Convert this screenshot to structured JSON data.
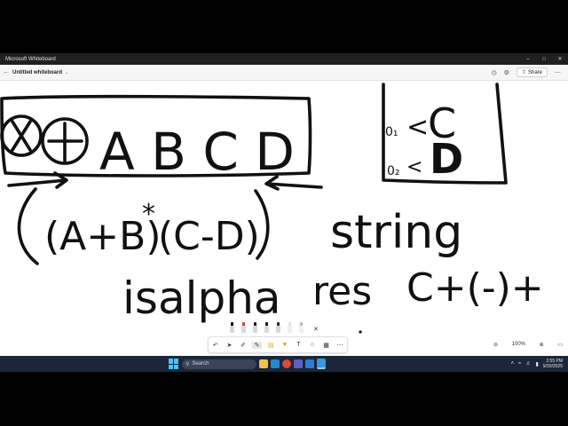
{
  "window": {
    "title": "Microsoft Whiteboard",
    "controls": [
      "minimize-icon",
      "maximize-icon",
      "close-icon"
    ]
  },
  "appbar": {
    "back_icon": "back-arrow-icon",
    "whiteboard_name": "Untitled whiteboard",
    "share_label": "Share",
    "icons": [
      "timer-icon",
      "settings-icon",
      "share-icon"
    ]
  },
  "canvas": {
    "ink_texts": {
      "ops": "&&",
      "letters": "A B C D",
      "expr_a": "(A+B)",
      "star": "*",
      "expr_b": "(C-D)",
      "word_string": "string",
      "word_isalpha": "isalpha",
      "word_res": "res",
      "expr_c": "C+(-)+",
      "box_c": "C",
      "box_d": "D",
      "box_sub1": "0₁",
      "box_sub2": "0₂",
      "arrow": "<"
    }
  },
  "pen_tray": {
    "pens": [
      {
        "name": "black-pen-icon",
        "tip": "#111111"
      },
      {
        "name": "red-pen-icon",
        "tip": "#d23a3a"
      },
      {
        "name": "blue-pen-icon",
        "tip": "#1a1a1a"
      },
      {
        "name": "black-pen-2-icon",
        "tip": "#1a1a1a"
      },
      {
        "name": "yellow-highlighter-icon",
        "tip": "#2a2a2a"
      },
      {
        "name": "eraser-icon",
        "tip": "#e0e0e0"
      },
      {
        "name": "lasso-icon",
        "tip": "#bbbbbb"
      }
    ],
    "close_icon": "✕"
  },
  "toolbar": {
    "items": [
      {
        "name": "undo-icon",
        "glyph": "↶"
      },
      {
        "name": "select-icon",
        "glyph": "➤"
      },
      {
        "name": "ink-tools-icon",
        "glyph": "✐"
      },
      {
        "name": "pen-icon",
        "glyph": "✎"
      },
      {
        "name": "sticky-note-icon",
        "glyph": "▤"
      },
      {
        "name": "reactions-icon",
        "glyph": "♥"
      },
      {
        "name": "text-icon",
        "glyph": "T"
      },
      {
        "name": "shapes-icon",
        "glyph": "○"
      },
      {
        "name": "templates-icon",
        "glyph": "▦"
      },
      {
        "name": "more-icon",
        "glyph": "⋯"
      }
    ]
  },
  "zoom": {
    "level": "100%",
    "zoom_out": "⊖",
    "zoom_in": "⊕",
    "fit_icon": "▭"
  },
  "taskbar": {
    "search_placeholder": "Search",
    "time": "3:55 PM",
    "date": "9/30/2025",
    "apps": [
      {
        "name": "file-explorer-icon",
        "color": "#f2c14e"
      },
      {
        "name": "edge-icon",
        "color": "#1f8ad2"
      },
      {
        "name": "chrome-icon",
        "color": "#d84a3a"
      },
      {
        "name": "teams-icon",
        "color": "#5b5fc7"
      },
      {
        "name": "store-icon",
        "color": "#2d7dd2"
      },
      {
        "name": "whiteboard-app-icon",
        "color": "#3a96dd"
      }
    ]
  }
}
